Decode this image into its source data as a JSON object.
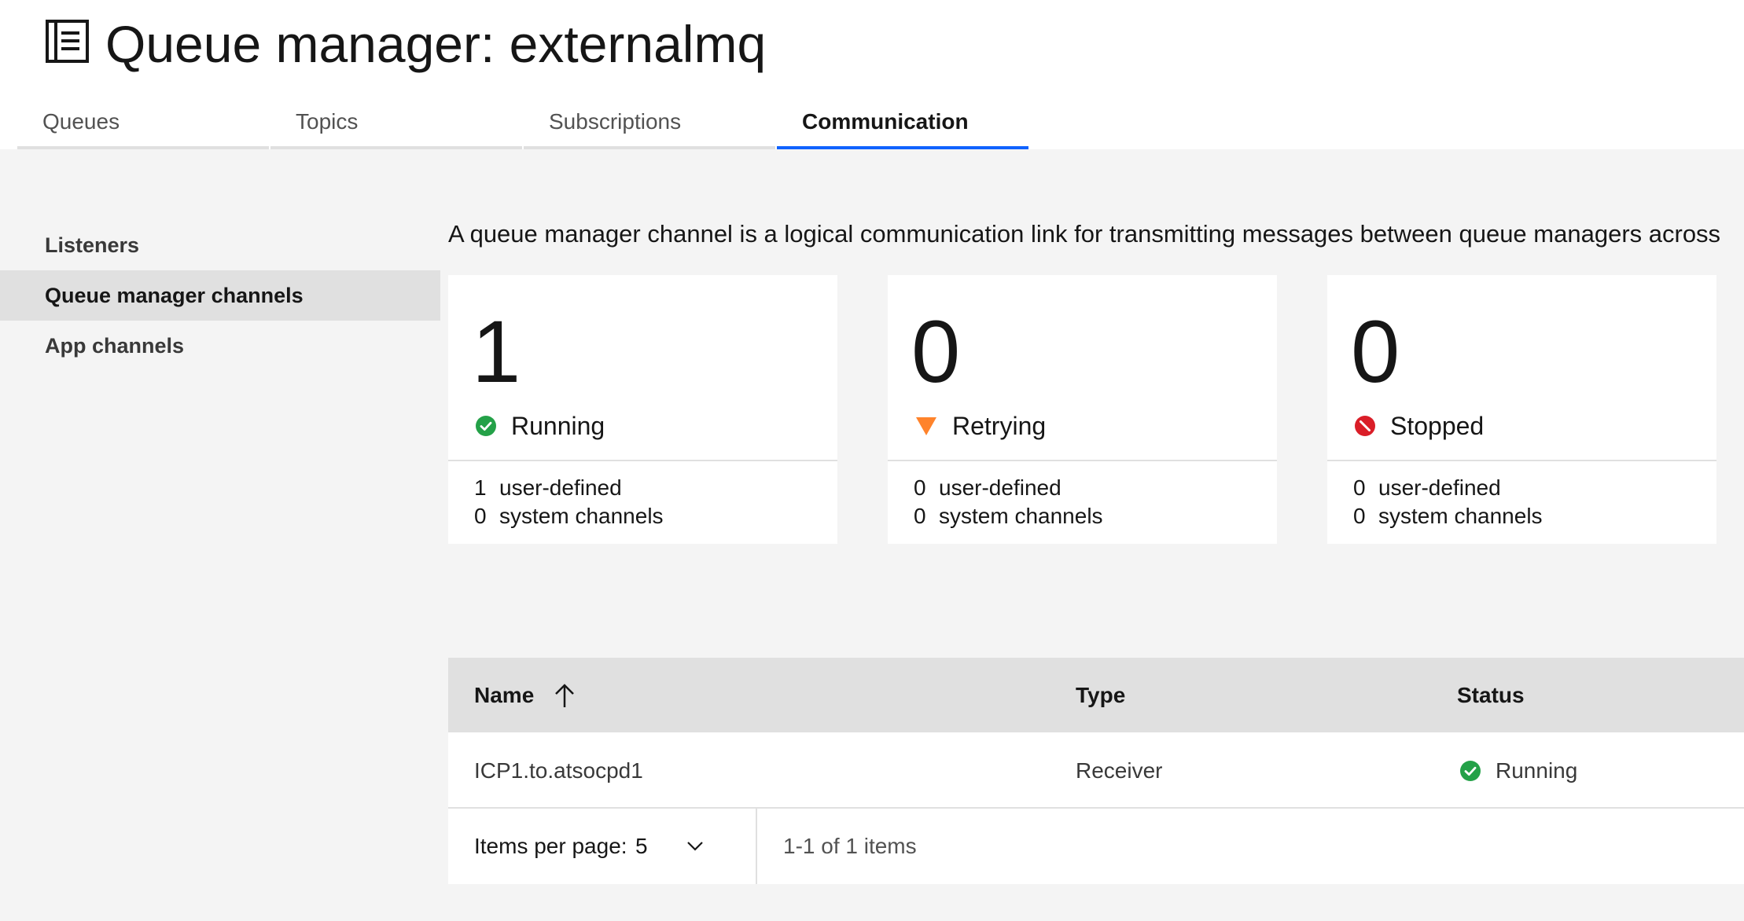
{
  "header": {
    "title": "Queue manager: externalmq",
    "icon": "queue-manager-icon"
  },
  "tabs": [
    {
      "label": "Queues"
    },
    {
      "label": "Topics"
    },
    {
      "label": "Subscriptions"
    },
    {
      "label": "Communication",
      "active": true
    }
  ],
  "sidebar": {
    "items": [
      {
        "label": "Listeners"
      },
      {
        "label": "Queue manager channels",
        "active": true
      },
      {
        "label": "App channels"
      }
    ]
  },
  "description": "A queue manager channel is a logical communication link for transmitting messages between queue managers across",
  "tiles": [
    {
      "count": "1",
      "status": "Running",
      "icon": "check-circle-icon",
      "user_defined": "1",
      "user_defined_label": "user-defined",
      "system": "0",
      "system_label": "system channels"
    },
    {
      "count": "0",
      "status": "Retrying",
      "icon": "warning-triangle-icon",
      "user_defined": "0",
      "user_defined_label": "user-defined",
      "system": "0",
      "system_label": "system channels"
    },
    {
      "count": "0",
      "status": "Stopped",
      "icon": "stopped-icon",
      "user_defined": "0",
      "user_defined_label": "user-defined",
      "system": "0",
      "system_label": "system channels"
    }
  ],
  "table": {
    "columns": [
      "Name",
      "Type",
      "Status"
    ],
    "sort": "ascending",
    "rows": [
      {
        "name": "ICP1.to.atsocpd1",
        "type": "Receiver",
        "status": "Running"
      }
    ]
  },
  "pagination": {
    "items_per_page_label": "Items per page:",
    "items_per_page": "5",
    "range": "1-1 of 1 items"
  },
  "colors": {
    "accent": "#0f62fe",
    "running": "#24a148",
    "retrying": "#ff832b",
    "stopped": "#da1e28"
  }
}
